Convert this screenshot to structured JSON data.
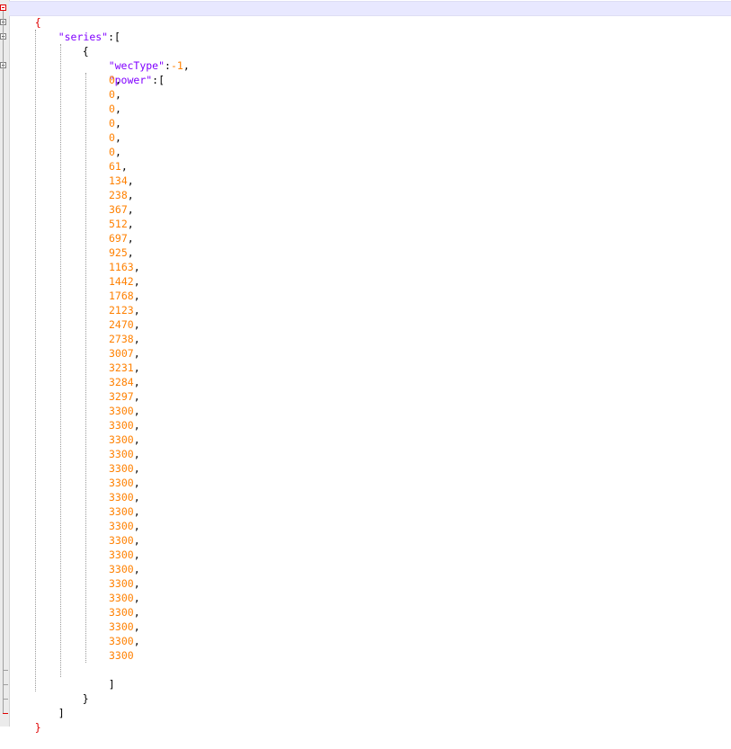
{
  "editor": {
    "language": "json",
    "colors": {
      "key": "#8000ff",
      "number": "#ff8000",
      "punctuation": "#000000",
      "root_brace": "#e00000",
      "current_line": "#e8e8ff",
      "gutter": "#ebebeb"
    },
    "text": {
      "open_root": "{",
      "series_key": "\"series\"",
      "colon_bracket": ":[",
      "open_obj": "{",
      "wectype_key": "\"wecType\"",
      "colon": ":",
      "wectype_value": "-1",
      "comma": ",",
      "power_key": "\"power\"",
      "close_bracket": "]",
      "close_obj": "}",
      "close_root": "}"
    },
    "power_values": [
      "0",
      "0",
      "0",
      "0",
      "0",
      "0",
      "61",
      "134",
      "238",
      "367",
      "512",
      "697",
      "925",
      "1163",
      "1442",
      "1768",
      "2123",
      "2470",
      "2738",
      "3007",
      "3231",
      "3284",
      "3297",
      "3300",
      "3300",
      "3300",
      "3300",
      "3300",
      "3300",
      "3300",
      "3300",
      "3300",
      "3300",
      "3300",
      "3300",
      "3300",
      "3300",
      "3300",
      "3300",
      "3300",
      "3300"
    ]
  }
}
